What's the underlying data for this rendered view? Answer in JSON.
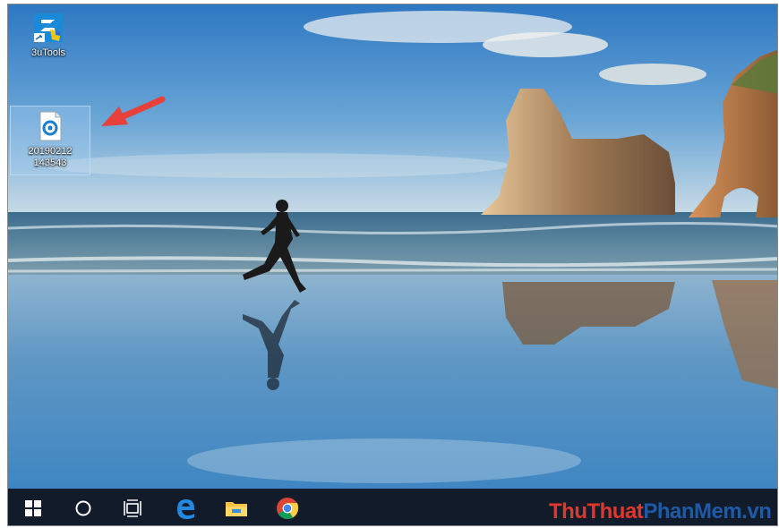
{
  "desktop": {
    "icons": [
      {
        "label": "3uTools",
        "icon": "3utools-icon"
      },
      {
        "label_line1": "20190212",
        "label_line2": "143543",
        "icon": "document-file-icon",
        "selected": true
      }
    ]
  },
  "taskbar": {
    "buttons": [
      {
        "name": "start-button",
        "icon": "windows-logo-icon"
      },
      {
        "name": "search-button",
        "icon": "cortana-circle-icon"
      },
      {
        "name": "task-view-button",
        "icon": "task-view-icon"
      },
      {
        "name": "edge-button",
        "icon": "edge-icon"
      },
      {
        "name": "file-explorer-button",
        "icon": "folder-icon"
      },
      {
        "name": "chrome-button",
        "icon": "chrome-icon"
      }
    ]
  },
  "watermark": {
    "part1": "ThuThuat",
    "part2": "PhanMem",
    "part3": ".vn"
  },
  "colors": {
    "taskbar": "#121b29",
    "arrow": "#e8403a",
    "watermark_red": "#e0372c",
    "watermark_blue": "#1e5aa8"
  }
}
